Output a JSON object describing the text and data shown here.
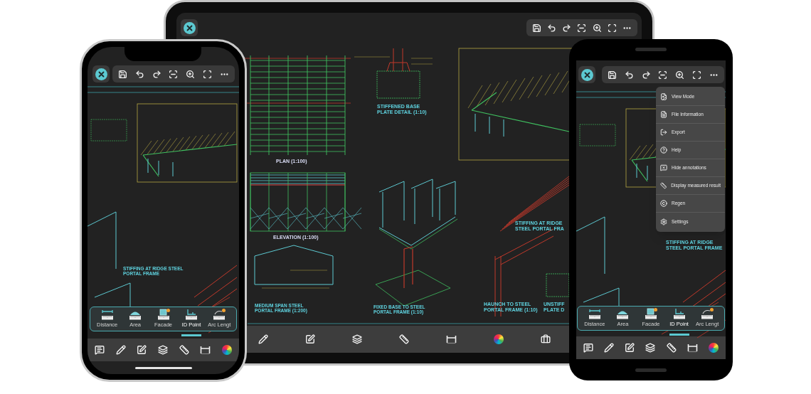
{
  "tablet": {
    "captions": [
      "PLAN (1:100)",
      "STIFFENED BASE PLATE DETAIL (1:10)",
      "ELEVATION (1:100)",
      "MEDIUM SPAN STEEL PORTAL FRAME (1:200)",
      "FIXED BASE TO STEEL PORTAL FRAME (1:10)",
      "HAUNCH TO STEEL PORTAL FRAME (1:10)",
      "STIFFING AT RIDGE STEEL PORTAL FRA",
      "UNSTIFF PLATE D"
    ]
  },
  "iphone": {
    "captions": [
      "STIFFING AT RIDGE STEEL PORTAL FRAME"
    ],
    "measure_tools": [
      {
        "kind": "distance",
        "label": "Distance",
        "selected": false
      },
      {
        "kind": "area",
        "label": "Area",
        "selected": false
      },
      {
        "kind": "facade",
        "label": "Facade",
        "selected": false
      },
      {
        "kind": "idpoint",
        "label": "ID Point",
        "selected": true
      },
      {
        "kind": "arc",
        "label": "Arc Lengt",
        "selected": false
      }
    ]
  },
  "android": {
    "captions": [
      "STIFFING AT RIDGE STEEL PORTAL FRAME"
    ],
    "menu": [
      "View Mode",
      "File Information",
      "Export",
      "Help",
      "Hide annotations",
      "Display measured result",
      "Regen",
      "Settings"
    ],
    "measure_tools": [
      {
        "kind": "distance",
        "label": "Distance",
        "selected": false
      },
      {
        "kind": "area",
        "label": "Area",
        "selected": false
      },
      {
        "kind": "facade",
        "label": "Facade",
        "selected": false
      },
      {
        "kind": "idpoint",
        "label": "ID Point",
        "selected": true
      },
      {
        "kind": "arc",
        "label": "Arc Lengt",
        "selected": false
      }
    ]
  }
}
